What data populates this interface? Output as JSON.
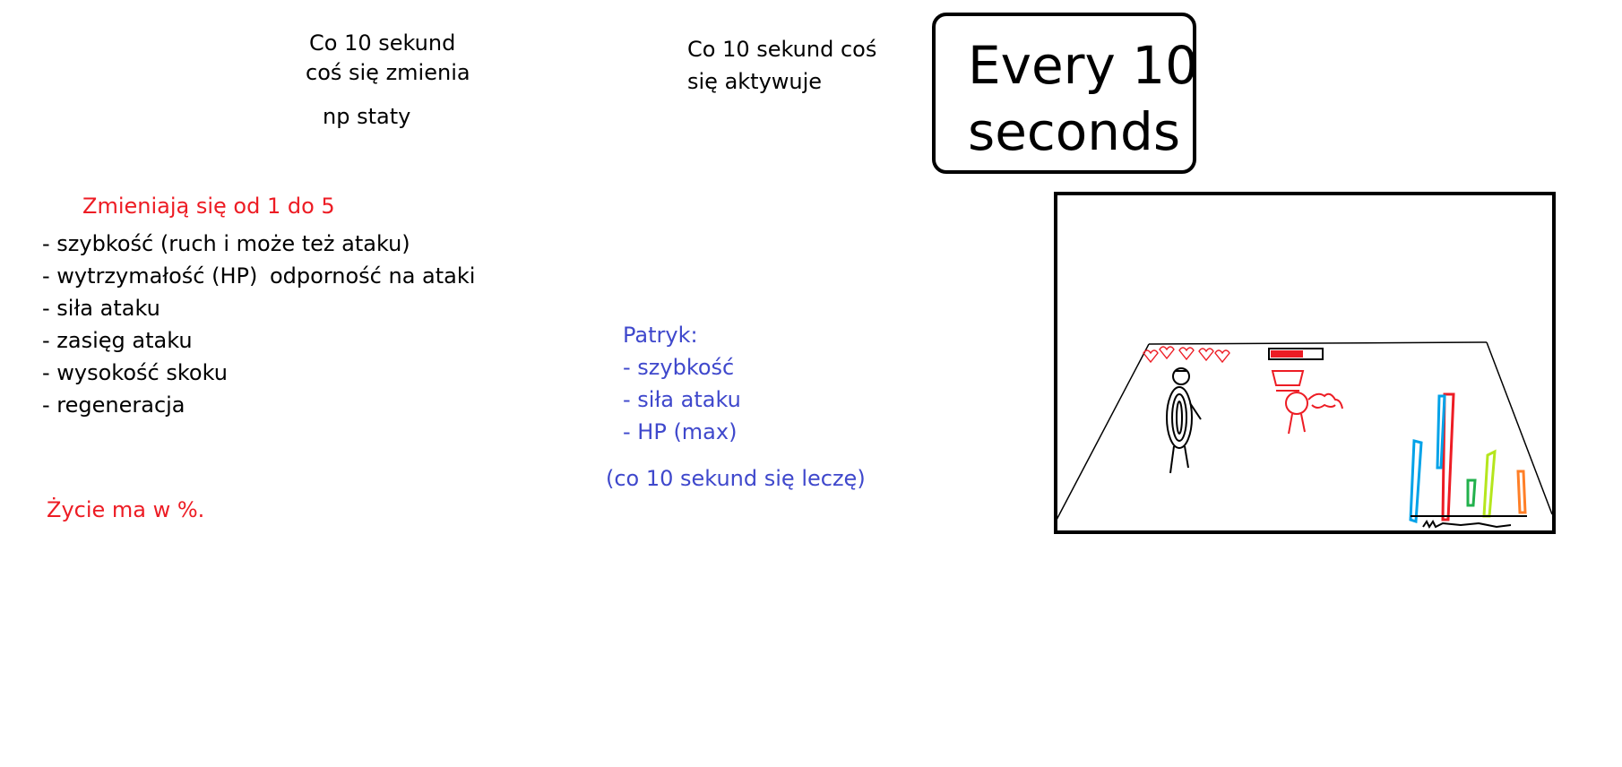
{
  "notes": {
    "changes_l1": "Co 10 sekund",
    "changes_l2": "coś się zmienia",
    "example": "np staty",
    "activates_l1": "Co 10 sekund coś",
    "activates_l2": "się aktywuje"
  },
  "title_box": {
    "line1": "Every 10",
    "line2": "seconds"
  },
  "stats": {
    "heading": "Zmieniają się od 1 do 5",
    "items": [
      "- szybkość (ruch i może też ataku)",
      "- wytrzymałość (HP)",
      "- siła ataku",
      "- zasięg ataku",
      "- wysokość skoku",
      "- regeneracja"
    ],
    "hp_extra": "odporność na ataki",
    "life_note": "Życie ma w %."
  },
  "patryk": {
    "heading": "Patryk:",
    "items": [
      "- szybkość",
      "- siła ataku",
      "- HP (max)"
    ],
    "note": "(co 10 sekund się leczę)"
  },
  "colors": {
    "red_text": "#ed1c24",
    "blue_text": "#3f48cc",
    "ink": "#000000"
  },
  "sketch": {
    "description_icons": [
      "heart-icon",
      "stick-figure-icon",
      "red-enemy-icon",
      "health-bar-icon",
      "crystal-icon"
    ]
  }
}
